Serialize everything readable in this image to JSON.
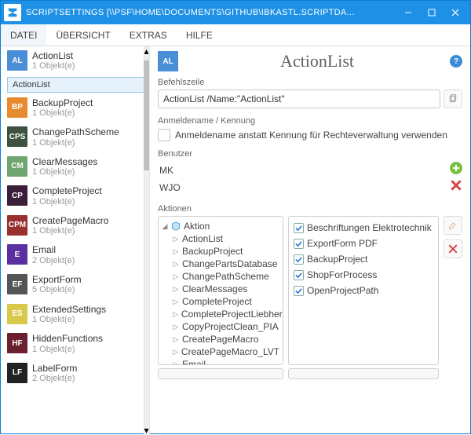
{
  "window": {
    "title": "SCRIPTSETTINGS [\\\\PSF\\HOME\\DOCUMENTS\\GITHUB\\IBKASTL.SCRIPTDA..."
  },
  "menu": {
    "items": [
      "DATEI",
      "ÜBERSICHT",
      "EXTRAS",
      "HILFE"
    ]
  },
  "sidebar": {
    "selected_sub": "ActionList",
    "items": [
      {
        "abbr": "AL",
        "color": "#4a8ed8",
        "name": "ActionList",
        "count": "1 Objekt(e)",
        "hasSub": true
      },
      {
        "abbr": "BP",
        "color": "#e68a2e",
        "name": "BackupProject",
        "count": "1 Objekt(e)"
      },
      {
        "abbr": "CPS",
        "color": "#3d5240",
        "name": "ChangePathScheme",
        "count": "1 Objekt(e)"
      },
      {
        "abbr": "CM",
        "color": "#6fa56f",
        "name": "ClearMessages",
        "count": "1 Objekt(e)"
      },
      {
        "abbr": "CP",
        "color": "#3b1f3a",
        "name": "CompleteProject",
        "count": "1 Objekt(e)"
      },
      {
        "abbr": "CPM",
        "color": "#9a2f2f",
        "name": "CreatePageMacro",
        "count": "1 Objekt(e)"
      },
      {
        "abbr": "E",
        "color": "#5a2fa0",
        "name": "Email",
        "count": "2 Objekt(e)"
      },
      {
        "abbr": "EF",
        "color": "#555555",
        "name": "ExportForm",
        "count": "5 Objekt(e)"
      },
      {
        "abbr": "ES",
        "color": "#d9c94a",
        "name": "ExtendedSettings",
        "count": "1 Objekt(e)"
      },
      {
        "abbr": "HF",
        "color": "#6b1f2f",
        "name": "HiddenFunctions",
        "count": "1 Objekt(e)"
      },
      {
        "abbr": "LF",
        "color": "#222222",
        "name": "LabelForm",
        "count": "2 Objekt(e)"
      }
    ]
  },
  "header": {
    "badge": "AL",
    "title": "ActionList"
  },
  "befehlszeile": {
    "label": "Befehlszeile",
    "value": "ActionList /Name:\"ActionList\""
  },
  "anmelde": {
    "label": "Anmeldename / Kennung",
    "checkbox": "Anmeldename anstatt Kennung für Rechteverwaltung verwenden"
  },
  "benutzer": {
    "label": "Benutzer",
    "rows": [
      "MK",
      "WJO"
    ]
  },
  "aktionen": {
    "label": "Aktionen",
    "root": "Aktion",
    "tree": [
      "ActionList",
      "BackupProject",
      "ChangePartsDatabase",
      "ChangePathScheme",
      "ClearMessages",
      "CompleteProject",
      "CompleteProjectLiebherr",
      "CopyProjectClean_PIA",
      "CreatePageMacro",
      "CreatePageMacro_LVT",
      "Email"
    ],
    "selected": [
      "Beschriftungen Elektrotechnik",
      "ExportForm PDF",
      "BackupProject",
      "ShopForProcess",
      "OpenProjectPath"
    ]
  }
}
